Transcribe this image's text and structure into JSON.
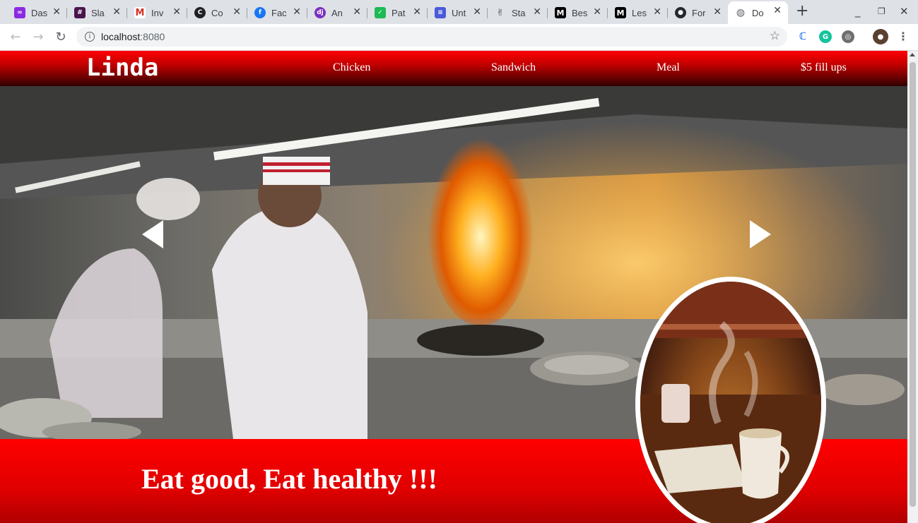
{
  "browser": {
    "tabs": [
      {
        "title": "Das",
        "icon": "monday-icon",
        "color": "#8a2be2"
      },
      {
        "title": "Sla",
        "icon": "slack-icon",
        "color": "#4a154b"
      },
      {
        "title": "Inv",
        "icon": "gmail-icon",
        "color": "#d93025"
      },
      {
        "title": "Co",
        "icon": "coursera-icon",
        "color": "#202124"
      },
      {
        "title": "Fac",
        "icon": "facebook-icon",
        "color": "#1877f2"
      },
      {
        "title": "An",
        "icon": "django-icon",
        "color": "#7b2fbe"
      },
      {
        "title": "Pat",
        "icon": "patreon-icon",
        "color": "#1db954"
      },
      {
        "title": "Unt",
        "icon": "docs-icon",
        "color": "#4a5ad8"
      },
      {
        "title": "Sta",
        "icon": "victory-hand-icon",
        "color": "#ffffff"
      },
      {
        "title": "Bes",
        "icon": "medium-icon",
        "color": "#000000"
      },
      {
        "title": "Les",
        "icon": "medium-icon",
        "color": "#000000"
      },
      {
        "title": "For",
        "icon": "github-icon",
        "color": "#24292e"
      },
      {
        "title": "Do",
        "icon": "globe-icon",
        "color": "#5f6368"
      }
    ],
    "url_host": "localhost",
    "url_port": ":8080"
  },
  "site": {
    "logo": "Linda",
    "nav": [
      "Chicken",
      "Sandwich",
      "Meal",
      "$5 fill ups"
    ],
    "tagline": "Eat good, Eat healthy !!!"
  },
  "colors": {
    "brand_red": "#ff0000",
    "nav_dark": "#300000"
  }
}
